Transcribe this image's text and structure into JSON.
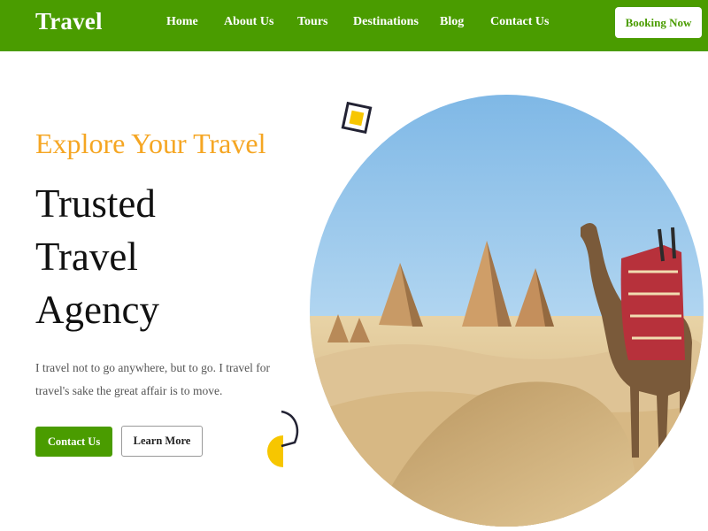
{
  "header": {
    "brand": "Travel",
    "nav": [
      {
        "label": "Home"
      },
      {
        "label": "About Us"
      },
      {
        "label": "Tours"
      },
      {
        "label": "Destinations"
      },
      {
        "label": "Blog"
      },
      {
        "label": "Contact Us"
      }
    ],
    "cta_label": "Booking Now"
  },
  "hero": {
    "eyebrow": "Explore Your Travel",
    "headline_lines": [
      "Trusted",
      "Travel",
      "Agency"
    ],
    "tagline": "I travel not to go anywhere, but to go. I travel for travel's sake the great affair is to move.",
    "primary_button": "Contact Us",
    "secondary_button": "Learn More"
  },
  "colors": {
    "brand_green": "#4a9c00",
    "accent_orange": "#f5a623",
    "accent_yellow": "#f7c600",
    "dark_outline": "#222233"
  },
  "icons": {
    "deco_square": "rotated-square-icon",
    "deco_half": "half-circle-icon"
  }
}
